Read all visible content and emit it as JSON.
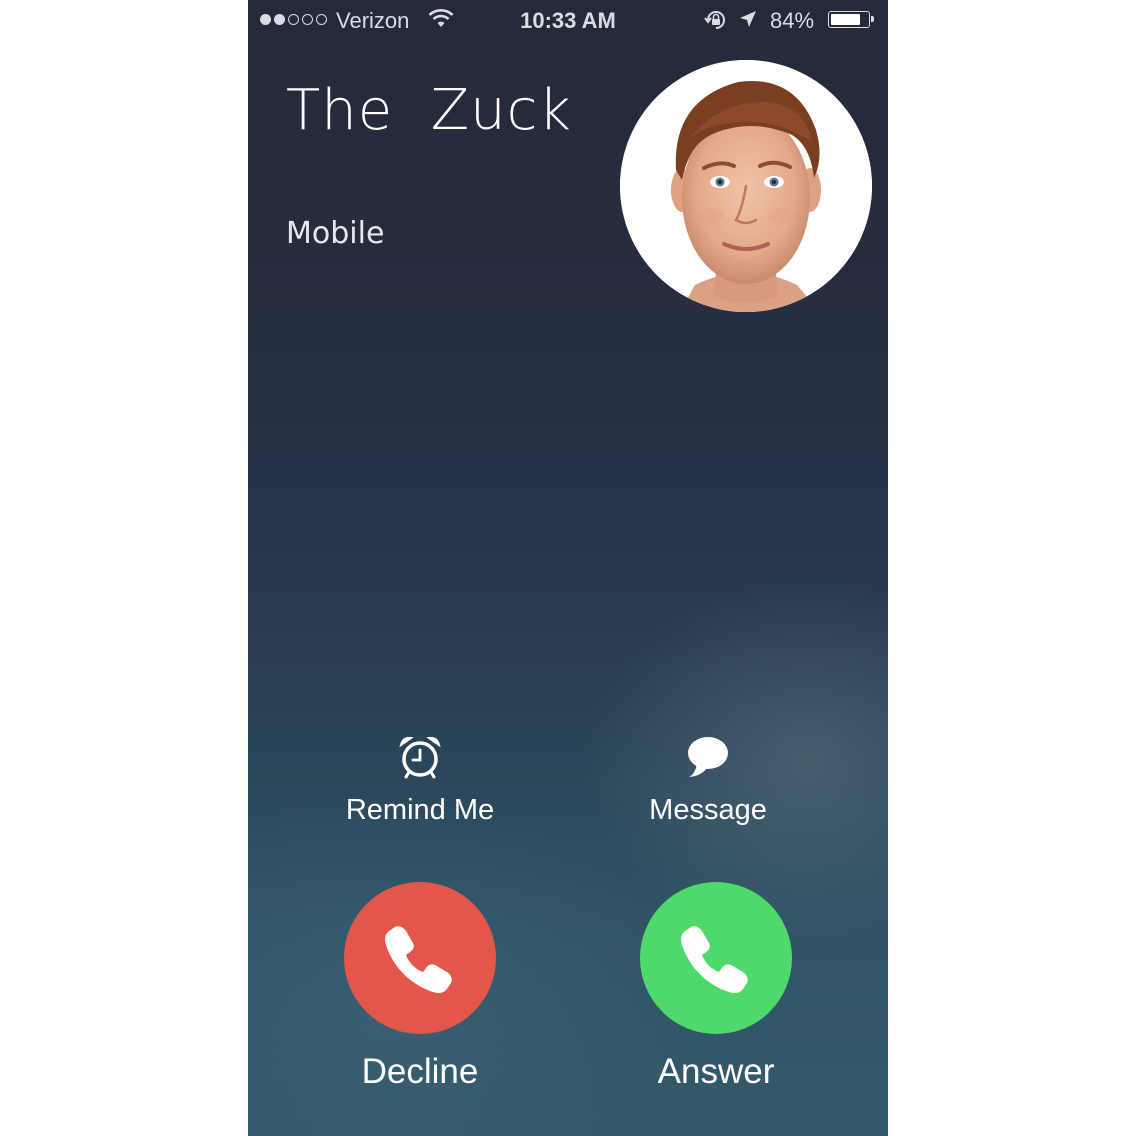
{
  "status_bar": {
    "signal_bars_filled": 2,
    "signal_bars_total": 5,
    "carrier": "Verizon",
    "time": "10:33 AM",
    "battery_percent": "84%",
    "battery_level": 0.84,
    "icons": [
      "wifi-icon",
      "rotation-lock-icon",
      "location-arrow-icon",
      "battery-icon"
    ]
  },
  "caller": {
    "name": "The  Zuck",
    "type": "Mobile",
    "avatar": "contact-photo"
  },
  "actions": {
    "remind_label": "Remind Me",
    "remind_icon": "alarm-clock-icon",
    "message_label": "Message",
    "message_icon": "speech-bubble-icon"
  },
  "call_buttons": {
    "decline_label": "Decline",
    "decline_color": "#e2574a",
    "answer_label": "Answer",
    "answer_color": "#4ed96a",
    "icon": "phone-handset-icon"
  }
}
